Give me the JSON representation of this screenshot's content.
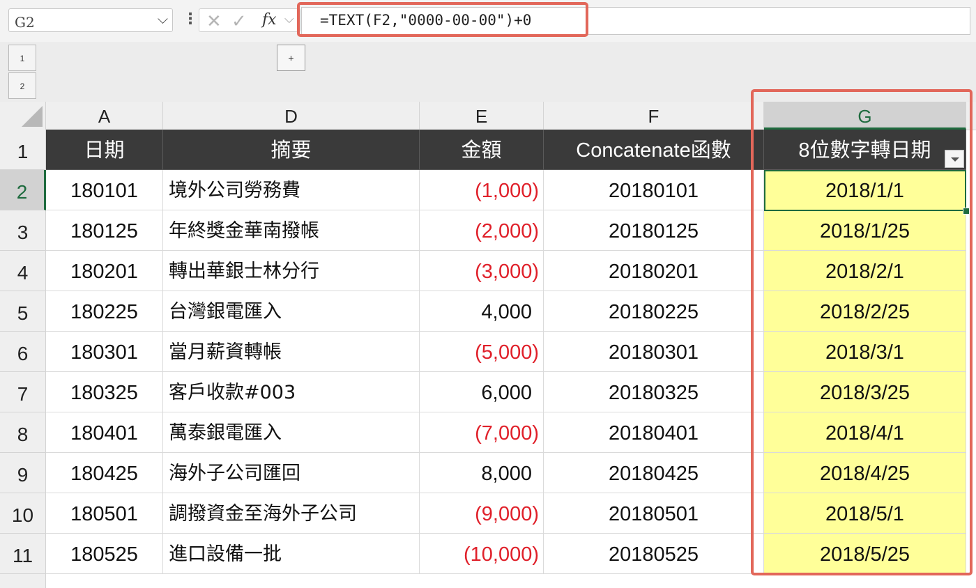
{
  "formula_bar": {
    "name_box": "G2",
    "fx_label": "fx",
    "formula": "=TEXT(F2,\"0000-00-00\")+0"
  },
  "outline": {
    "levels": [
      "1",
      "2"
    ],
    "expand_label": "+"
  },
  "columns": [
    "A",
    "D",
    "E",
    "F",
    "G"
  ],
  "row_numbers": [
    "1",
    "2",
    "3",
    "4",
    "5",
    "6",
    "7",
    "8",
    "9",
    "10",
    "11"
  ],
  "table": {
    "headers": [
      "日期",
      "摘要",
      "金額",
      "Concatenate函數",
      "8位數字轉日期"
    ],
    "rows": [
      {
        "date": "180101",
        "desc": "境外公司勞務費",
        "amount": "(1,000)",
        "neg": true,
        "concat": "20180101",
        "converted": "2018/1/1"
      },
      {
        "date": "180125",
        "desc": "年終獎金華南撥帳",
        "amount": "(2,000)",
        "neg": true,
        "concat": "20180125",
        "converted": "2018/1/25"
      },
      {
        "date": "180201",
        "desc": "轉出華銀士林分行",
        "amount": "(3,000)",
        "neg": true,
        "concat": "20180201",
        "converted": "2018/2/1"
      },
      {
        "date": "180225",
        "desc": "台灣銀電匯入",
        "amount": "4,000",
        "neg": false,
        "concat": "20180225",
        "converted": "2018/2/25"
      },
      {
        "date": "180301",
        "desc": "當月薪資轉帳",
        "amount": "(5,000)",
        "neg": true,
        "concat": "20180301",
        "converted": "2018/3/1"
      },
      {
        "date": "180325",
        "desc": "客戶收款#003",
        "amount": "6,000",
        "neg": false,
        "concat": "20180325",
        "converted": "2018/3/25"
      },
      {
        "date": "180401",
        "desc": "萬泰銀電匯入",
        "amount": "(7,000)",
        "neg": true,
        "concat": "20180401",
        "converted": "2018/4/1"
      },
      {
        "date": "180425",
        "desc": "海外子公司匯回",
        "amount": "8,000",
        "neg": false,
        "concat": "20180425",
        "converted": "2018/4/25"
      },
      {
        "date": "180501",
        "desc": "調撥資金至海外子公司",
        "amount": "(9,000)",
        "neg": true,
        "concat": "20180501",
        "converted": "2018/5/1"
      },
      {
        "date": "180525",
        "desc": "進口設備一批",
        "amount": "(10,000)",
        "neg": true,
        "concat": "20180525",
        "converted": "2018/5/25"
      }
    ]
  },
  "colors": {
    "header_bg": "#3a3a3a",
    "highlight_fill": "#ffff99",
    "negative": "#e0202a",
    "annotation_border": "#e2675a",
    "selection": "#1e6b3e"
  }
}
